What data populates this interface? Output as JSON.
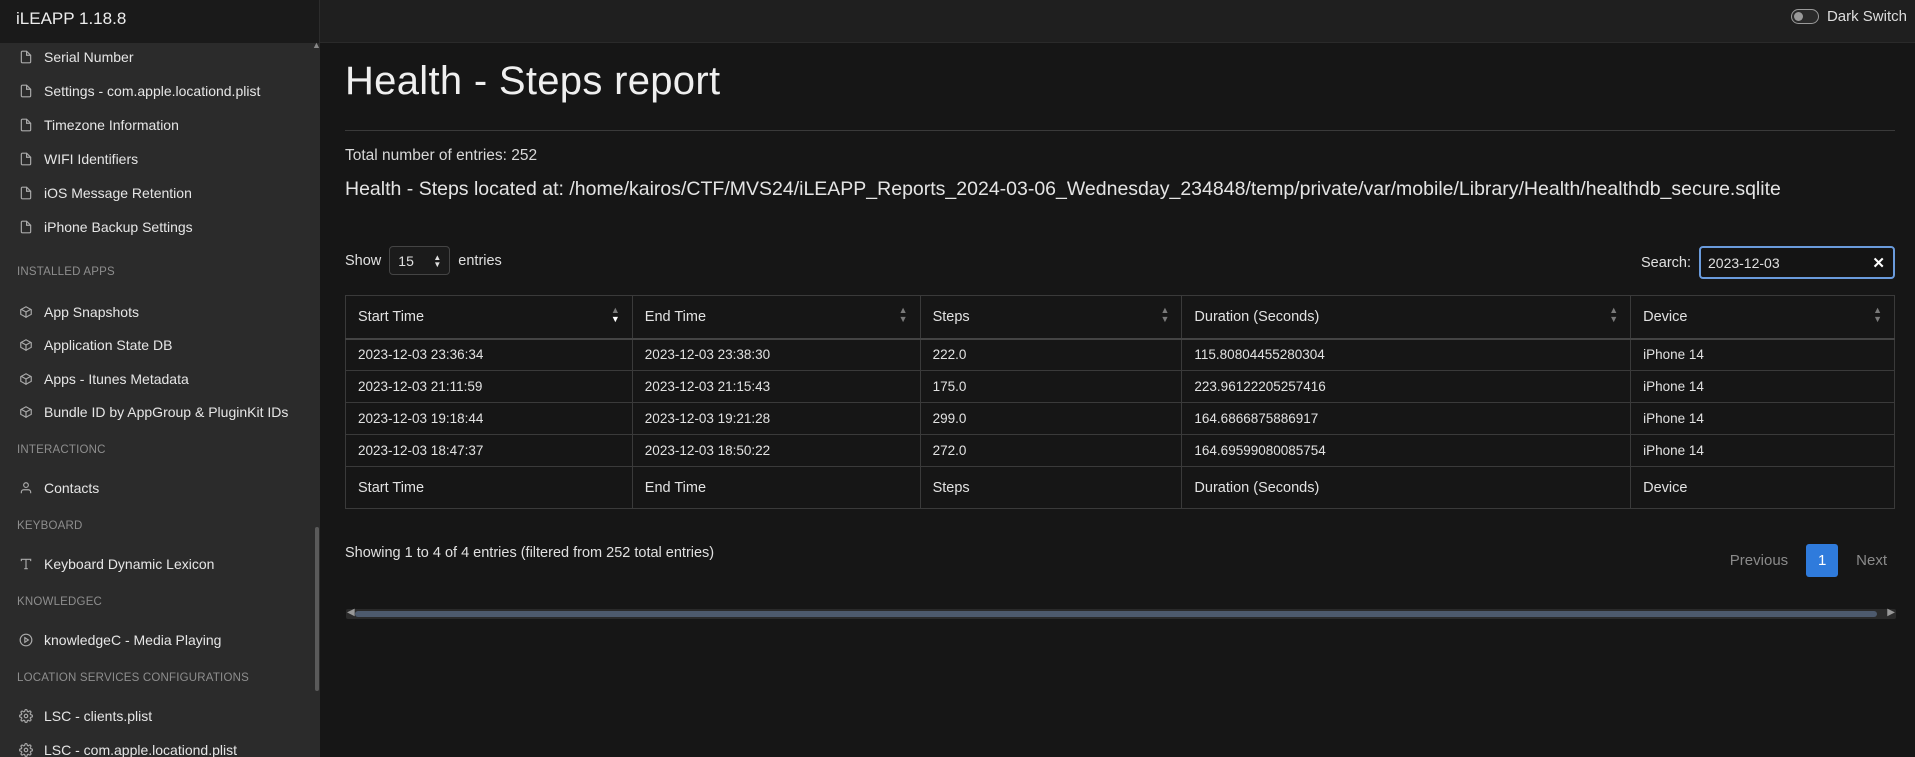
{
  "app": {
    "title": "iLEAPP 1.18.8",
    "dark_switch_label": "Dark Switch"
  },
  "sidebar": {
    "items_top": [
      {
        "label": "Serial Number",
        "icon": "file-icon"
      },
      {
        "label": "Settings - com.apple.locationd.plist",
        "icon": "file-icon"
      },
      {
        "label": "Timezone Information",
        "icon": "file-icon"
      },
      {
        "label": "WIFI Identifiers",
        "icon": "file-icon"
      },
      {
        "label": "iOS Message Retention",
        "icon": "file-icon"
      },
      {
        "label": "iPhone Backup Settings",
        "icon": "file-icon"
      }
    ],
    "section_installed": "INSTALLED APPS",
    "items_installed": [
      {
        "label": "App Snapshots",
        "icon": "package-icon"
      },
      {
        "label": "Application State DB",
        "icon": "package-icon"
      },
      {
        "label": "Apps - Itunes Metadata",
        "icon": "package-icon"
      },
      {
        "label": "Bundle ID by AppGroup & PluginKit IDs",
        "icon": "package-icon"
      }
    ],
    "section_interaction": "INTERACTIONC",
    "items_interaction": [
      {
        "label": "Contacts",
        "icon": "user-icon"
      }
    ],
    "section_keyboard": "KEYBOARD",
    "items_keyboard": [
      {
        "label": "Keyboard Dynamic Lexicon",
        "icon": "type-icon"
      }
    ],
    "section_knowledge": "KNOWLEDGEC",
    "items_knowledge": [
      {
        "label": "knowledgeC - Media Playing",
        "icon": "play-circle-icon"
      }
    ],
    "section_location": "LOCATION SERVICES CONFIGURATIONS",
    "items_location": [
      {
        "label": "LSC - clients.plist",
        "icon": "settings-icon"
      },
      {
        "label": "LSC - com.apple.locationd.plist",
        "icon": "settings-icon"
      }
    ]
  },
  "main": {
    "title": "Health - Steps report",
    "total_entries": "Total number of entries: 252",
    "located_at": "Health - Steps located at: /home/kairos/CTF/MVS24/iLEAPP_Reports_2024-03-06_Wednesday_234848/temp/private/var/mobile/Library/Health/healthdb_secure.sqlite",
    "show_label": "Show",
    "show_value": "15",
    "entries_label": "entries",
    "search_label": "Search:",
    "search_value": "2023-12-03",
    "table": {
      "headers": [
        "Start Time",
        "End Time",
        "Steps",
        "Duration (Seconds)",
        "Device"
      ],
      "rows": [
        [
          "2023-12-03 23:36:34",
          "2023-12-03 23:38:30",
          "222.0",
          "115.80804455280304",
          "iPhone 14"
        ],
        [
          "2023-12-03 21:11:59",
          "2023-12-03 21:15:43",
          "175.0",
          "223.96122205257416",
          "iPhone 14"
        ],
        [
          "2023-12-03 19:18:44",
          "2023-12-03 19:21:28",
          "299.0",
          "164.6866875886917",
          "iPhone 14"
        ],
        [
          "2023-12-03 18:47:37",
          "2023-12-03 18:50:22",
          "272.0",
          "164.69599080085754",
          "iPhone 14"
        ]
      ]
    },
    "info": "Showing 1 to 4 of 4 entries (filtered from 252 total entries)",
    "pager": {
      "previous": "Previous",
      "current": "1",
      "next": "Next"
    }
  }
}
